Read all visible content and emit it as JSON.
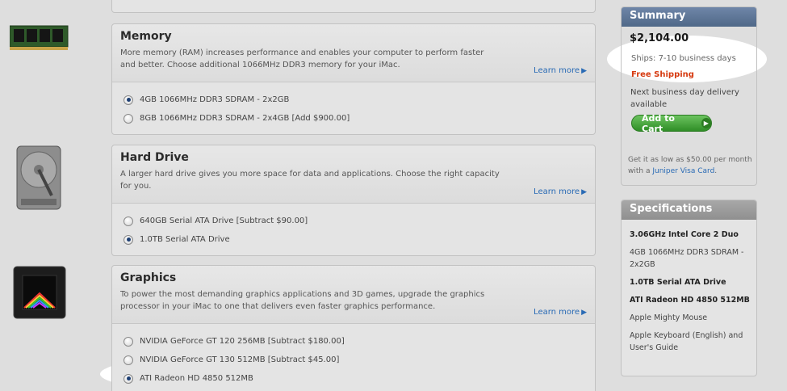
{
  "sections": {
    "memory": {
      "title": "Memory",
      "description": "More memory (RAM) increases performance and enables your computer to perform faster and better. Choose additional 1066MHz DDR3 memory for your iMac.",
      "learn_more": "Learn more",
      "options": [
        {
          "label": "4GB 1066MHz DDR3 SDRAM - 2x2GB",
          "selected": true
        },
        {
          "label": "8GB 1066MHz DDR3 SDRAM - 2x4GB [Add $900.00]",
          "selected": false
        }
      ]
    },
    "hard_drive": {
      "title": "Hard Drive",
      "description": "A larger hard drive gives you more space for data and applications. Choose the right capacity for you.",
      "learn_more": "Learn more",
      "options": [
        {
          "label": "640GB Serial ATA Drive [Subtract $90.00]",
          "selected": false
        },
        {
          "label": "1.0TB Serial ATA Drive",
          "selected": true
        }
      ]
    },
    "graphics": {
      "title": "Graphics",
      "description": "To power the most demanding graphics applications and 3D games, upgrade the graphics processor in your iMac to one that delivers even faster graphics performance.",
      "learn_more": "Learn more",
      "options": [
        {
          "label": "NVIDIA GeForce GT 120 256MB [Subtract $180.00]",
          "selected": false
        },
        {
          "label": "NVIDIA GeForce GT 130 512MB [Subtract $45.00]",
          "selected": false
        },
        {
          "label": "ATI Radeon HD 4850 512MB",
          "selected": true
        }
      ]
    }
  },
  "summary": {
    "heading": "Summary",
    "price": "$2,104.00",
    "ships": "Ships: 7-10 business days",
    "free_shipping": "Free Shipping",
    "next_day": "Next business day delivery available",
    "add_to_cart": "Add to Cart",
    "financing_prefix": "Get it as low as $50.00 per month with a ",
    "financing_link": "Juniper Visa Card",
    "financing_suffix": "."
  },
  "specifications": {
    "heading": "Specifications",
    "items": [
      {
        "text": "3.06GHz Intel Core 2 Duo",
        "bold": true
      },
      {
        "text": "4GB 1066MHz DDR3 SDRAM - 2x2GB",
        "bold": false
      },
      {
        "text": "1.0TB Serial ATA Drive",
        "bold": true
      },
      {
        "text": "ATI Radeon HD 4850 512MB",
        "bold": true
      },
      {
        "text": "Apple Mighty Mouse",
        "bold": false
      },
      {
        "text": "Apple Keyboard (English) and User's Guide",
        "bold": false
      }
    ]
  },
  "colors": {
    "link": "#2a6bb5",
    "free_shipping": "#d63a10",
    "cart_button": "#3a9a2f",
    "summary_header": "#5d7596",
    "spec_header": "#9b9b9b"
  }
}
